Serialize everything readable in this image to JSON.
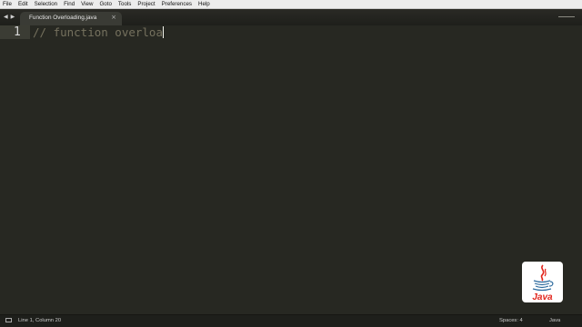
{
  "menu": {
    "items": [
      "File",
      "Edit",
      "Selection",
      "Find",
      "View",
      "Goto",
      "Tools",
      "Project",
      "Preferences",
      "Help"
    ]
  },
  "tabs": {
    "nav_left": "◀",
    "nav_right": "▶",
    "active_tab": "Function Overloading.java",
    "close_glyph": "×"
  },
  "editor": {
    "line_number": "1",
    "code": "// function overloa",
    "comment_color": "#75715e",
    "background_color": "#272822"
  },
  "logo": {
    "text": "Java",
    "icon": "java-coffee-cup-icon",
    "brand_red": "#e2231a",
    "brand_blue": "#2d6b9e"
  },
  "status": {
    "position": "Line 1, Column 20",
    "spaces": "Spaces: 4",
    "syntax": "Java"
  }
}
